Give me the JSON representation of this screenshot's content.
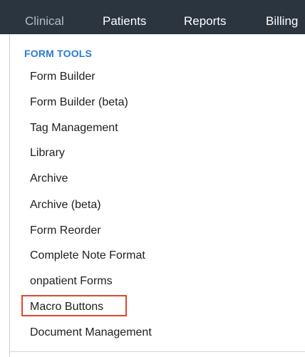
{
  "nav": {
    "items": [
      {
        "label": "Clinical",
        "active": true
      },
      {
        "label": "Patients",
        "active": false
      },
      {
        "label": "Reports",
        "active": false
      },
      {
        "label": "Billing",
        "active": false
      }
    ]
  },
  "dropdown": {
    "heading": "FORM TOOLS",
    "items": [
      {
        "label": "Form Builder"
      },
      {
        "label": "Form Builder (beta)"
      },
      {
        "label": "Tag Management"
      },
      {
        "label": "Library"
      },
      {
        "label": "Archive"
      },
      {
        "label": "Archive (beta)"
      },
      {
        "label": "Form Reorder"
      },
      {
        "label": "Complete Note Format"
      },
      {
        "label": "onpatient Forms"
      },
      {
        "label": "Macro Buttons",
        "highlighted": true
      },
      {
        "label": "Document Management"
      }
    ]
  },
  "colors": {
    "nav_background": "#2b3540",
    "heading": "#2a7bd4",
    "highlight_border": "#e2452f"
  }
}
